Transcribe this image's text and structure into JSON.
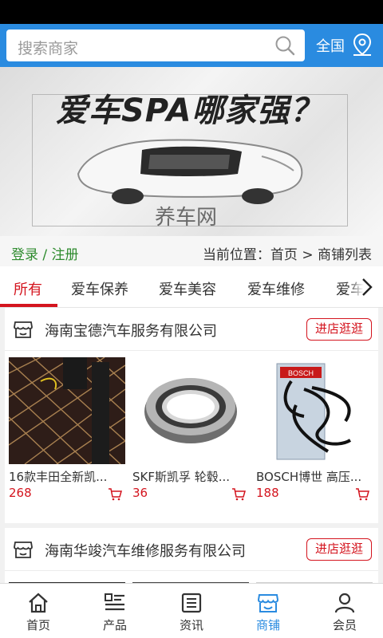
{
  "search": {
    "placeholder": "搜索商家"
  },
  "region": {
    "label": "全国"
  },
  "banner": {
    "title": "爱车SPA哪家强？",
    "subtitle": "养车网"
  },
  "location": {
    "login_label": "登录 / 注册",
    "current": "当前位置：首页 > 商铺列表"
  },
  "tabs": [
    {
      "label": "所有",
      "active": true
    },
    {
      "label": "爱车保养",
      "active": false
    },
    {
      "label": "爱车美容",
      "active": false
    },
    {
      "label": "爱车维修",
      "active": false
    },
    {
      "label": "爱车",
      "active": false
    }
  ],
  "shops": [
    {
      "name": "海南宝德汽车服务有限公司",
      "enter_label": "进店逛逛",
      "products": [
        {
          "name": "16款丰田全新凯...",
          "price": "268"
        },
        {
          "name": "SKF斯凯孚 轮毂...",
          "price": "36"
        },
        {
          "name": "BOSCH博世 高压...",
          "price": "188"
        }
      ]
    },
    {
      "name": "海南华竣汽车维修服务有限公司",
      "enter_label": "进店逛逛",
      "products": []
    }
  ],
  "product_image_text": {
    "bosch_logo": "BOSCH"
  },
  "nav": [
    {
      "label": "首页",
      "icon": "home-icon",
      "active": false
    },
    {
      "label": "产品",
      "icon": "list-icon",
      "active": false
    },
    {
      "label": "资讯",
      "icon": "news-icon",
      "active": false
    },
    {
      "label": "商铺",
      "icon": "store-icon",
      "active": true
    },
    {
      "label": "会员",
      "icon": "user-icon",
      "active": false
    }
  ],
  "colors": {
    "primary": "#2a8be0",
    "accent": "#d4141e",
    "login": "#2e8b2e"
  }
}
